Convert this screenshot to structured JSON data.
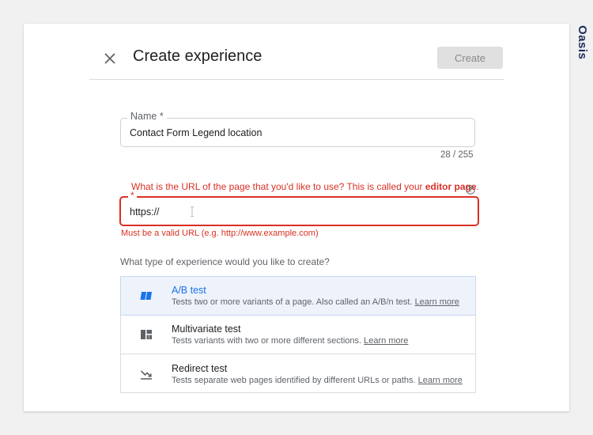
{
  "watermark": "Oasis",
  "dialog": {
    "title": "Create experience",
    "create_label": "Create"
  },
  "name_field": {
    "label": "Name *",
    "value": "Contact Form Legend location",
    "counter": "28 / 255"
  },
  "url_field": {
    "question_prefix": "What is the URL of the page that you'd like to use? This is called your ",
    "question_emphasis": "editor page",
    "question_suffix": ".",
    "required_marker": "*",
    "value": "https://",
    "error": "Must be a valid URL (e.g. http://www.example.com)"
  },
  "experience_types": {
    "question": "What type of experience would you like to create?",
    "items": [
      {
        "title": "A/B test",
        "description": "Tests two or more variants of a page. Also called an A/B/n test.",
        "learn_more": "Learn more",
        "icon": "ab-test-icon",
        "selected": true
      },
      {
        "title": "Multivariate test",
        "description": "Tests variants with two or more different sections.",
        "learn_more": "Learn more",
        "icon": "multivariate-icon",
        "selected": false
      },
      {
        "title": "Redirect test",
        "description": "Tests separate web pages identified by different URLs or paths.",
        "learn_more": "Learn more",
        "icon": "redirect-icon",
        "selected": false
      }
    ]
  },
  "colors": {
    "error": "#d93025",
    "accent": "#1a73e8",
    "selected_bg": "#eef3fb"
  }
}
